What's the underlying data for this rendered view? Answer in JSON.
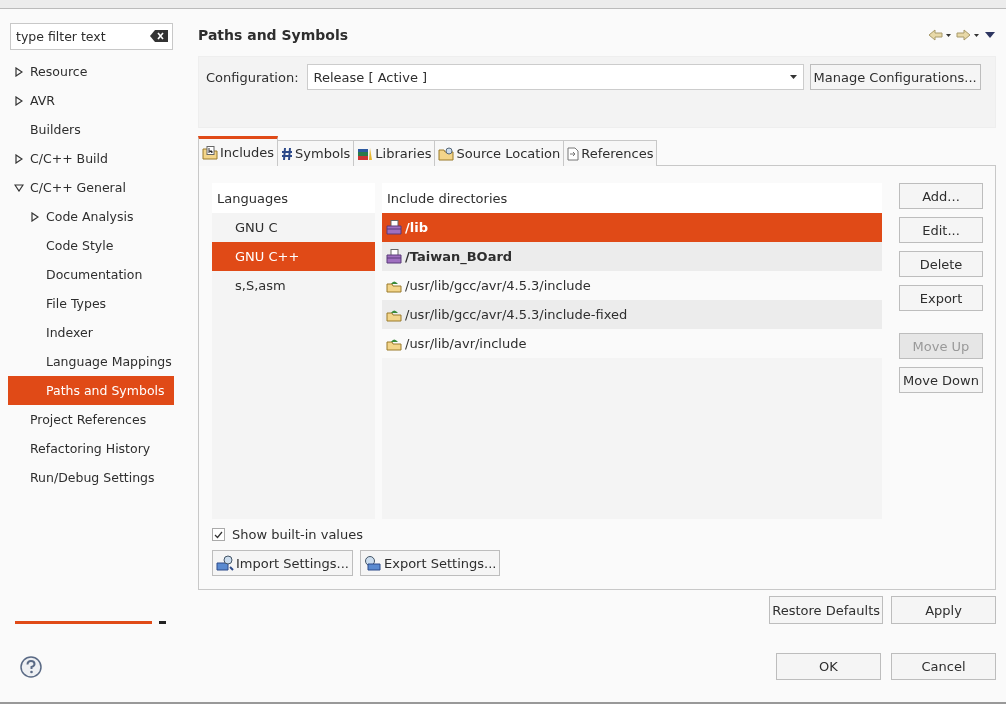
{
  "filter": {
    "placeholder": "type filter text"
  },
  "tree": [
    {
      "label": "Resource",
      "kind": "folder",
      "expanded": false,
      "selected": false
    },
    {
      "label": "AVR",
      "kind": "folder",
      "expanded": false,
      "selected": false
    },
    {
      "label": "Builders",
      "kind": "leaf",
      "selected": false
    },
    {
      "label": "C/C++ Build",
      "kind": "folder",
      "expanded": false,
      "selected": false
    },
    {
      "label": "C/C++ General",
      "kind": "folder",
      "expanded": true,
      "selected": false,
      "children": [
        {
          "label": "Code Analysis",
          "kind": "folder",
          "expanded": false,
          "selected": false
        },
        {
          "label": "Code Style",
          "kind": "leaf",
          "selected": false
        },
        {
          "label": "Documentation",
          "kind": "leaf",
          "selected": false
        },
        {
          "label": "File Types",
          "kind": "leaf",
          "selected": false
        },
        {
          "label": "Indexer",
          "kind": "leaf",
          "selected": false
        },
        {
          "label": "Language Mappings",
          "kind": "leaf",
          "selected": false
        },
        {
          "label": "Paths and Symbols",
          "kind": "leaf",
          "selected": true
        }
      ]
    },
    {
      "label": "Project References",
      "kind": "leaf",
      "selected": false
    },
    {
      "label": "Refactoring History",
      "kind": "leaf",
      "selected": false
    },
    {
      "label": "Run/Debug Settings",
      "kind": "leaf",
      "selected": false
    }
  ],
  "page_title": "Paths and Symbols",
  "configuration": {
    "label": "Configuration:",
    "value": "Release  [ Active ]",
    "button": "Manage Configurations..."
  },
  "tabs": [
    {
      "label": "Includes",
      "kind": "includes",
      "selected": true
    },
    {
      "label": "Symbols",
      "kind": "symbols",
      "selected": false
    },
    {
      "label": "Libraries",
      "kind": "libraries",
      "selected": false
    },
    {
      "label": "Source Location",
      "kind": "source",
      "selected": false
    },
    {
      "label": "References",
      "kind": "references",
      "selected": false
    }
  ],
  "languages": {
    "header": "Languages",
    "items": [
      {
        "label": "GNU C",
        "selected": false
      },
      {
        "label": "GNU C++",
        "selected": true
      },
      {
        "label": "s,S,asm",
        "selected": false
      }
    ]
  },
  "directories": {
    "header": "Include directories",
    "items": [
      {
        "path": "/lib",
        "kind": "workspace",
        "selected": true
      },
      {
        "path": "/Taiwan_BOard",
        "kind": "workspace",
        "selected": false
      },
      {
        "path": "/usr/lib/gcc/avr/4.5.3/include",
        "kind": "system",
        "selected": false
      },
      {
        "path": "/usr/lib/gcc/avr/4.5.3/include-fixed",
        "kind": "system",
        "selected": false
      },
      {
        "path": "/usr/lib/avr/include",
        "kind": "system",
        "selected": false
      }
    ]
  },
  "side_buttons": [
    {
      "label": "Add...",
      "disabled": false
    },
    {
      "label": "Edit...",
      "disabled": false
    },
    {
      "label": "Delete",
      "disabled": false
    },
    {
      "label": "Export",
      "disabled": false
    },
    {
      "label": "Move Up",
      "disabled": true
    },
    {
      "label": "Move Down",
      "disabled": false
    }
  ],
  "show_builtin": {
    "label": "Show built-in values",
    "checked": true
  },
  "settings_buttons": [
    {
      "label": "Import Settings...",
      "kind": "import"
    },
    {
      "label": "Export Settings...",
      "kind": "export"
    }
  ],
  "page_buttons": [
    "Restore Defaults",
    "Apply"
  ],
  "dialog_buttons": [
    "OK",
    "Cancel"
  ]
}
